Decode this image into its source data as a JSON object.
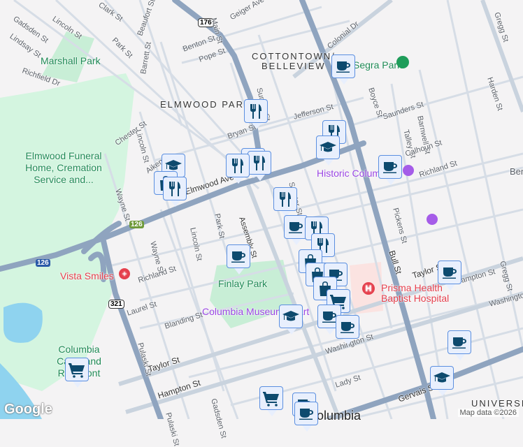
{
  "map": {
    "neighborhoods": [
      "ELMWOOD PARK",
      "COTTONTOWN/",
      "BELLEVIEW",
      "UNIVERSITY",
      "Ben"
    ],
    "parks": [
      "Marshall Park",
      "Elmwood Funeral Home, Cremation Service and...",
      "Finlay Park",
      "Columbia Canal and Riverfront",
      "Segra Park"
    ],
    "pois": {
      "vista_smiles": "Vista Smiles",
      "prisma_1": "Prisma Health",
      "prisma_2": "Baptist Hospital",
      "historic_columbia": "Historic Columbia",
      "museum": "Columbia Museum of Art",
      "city": "Columbia"
    },
    "streets": [
      "Gadsden St",
      "Lincoln St",
      "Clark St",
      "Park St",
      "Beaufort St",
      "Main St",
      "Geiger Ave",
      "Lindsay St",
      "Richfield Dr",
      "Benton St",
      "Pope St",
      "Barrett St",
      "Colonial Dr",
      "Sumter St",
      "Jefferson St",
      "Bull St",
      "Bryan St",
      "Chester St",
      "Lincoln St",
      "Aiken St",
      "Wayne St",
      "Elmwood Ave",
      "Assembly St",
      "Saunders St",
      "Boyce St",
      "Talley St",
      "Barnwell St",
      "Calhoun St",
      "Richland St",
      "Pickens St",
      "Harden St",
      "Gregg St",
      "Richland St",
      "Laurel St",
      "Blanding St",
      "Pulaski St",
      "Taylor St",
      "Hampton St",
      "Washington St",
      "Lady St",
      "Gervais St",
      "Taylor St",
      "Hampton St",
      "Washington St",
      "Gadsden St",
      "Wayne St",
      "Lincoln St",
      "Park St",
      "Sumter St",
      "Pulaski St",
      "Gregg St"
    ],
    "shields": [
      "176",
      "126",
      "126",
      "321"
    ],
    "attribution": "Map data ©2026",
    "logo": "Google"
  },
  "marker_types": [
    "restaurant-icon",
    "coffee-icon",
    "school-icon",
    "shopping-bag-icon",
    "shopping-cart-icon"
  ],
  "colors": {
    "marker_fill": "#e8effd",
    "marker_border": "#5b8fe0",
    "icon": "#0d4a6e",
    "highway": "#8fa4bf",
    "park": "#d4f5e0",
    "water": "#8fd3ef"
  }
}
